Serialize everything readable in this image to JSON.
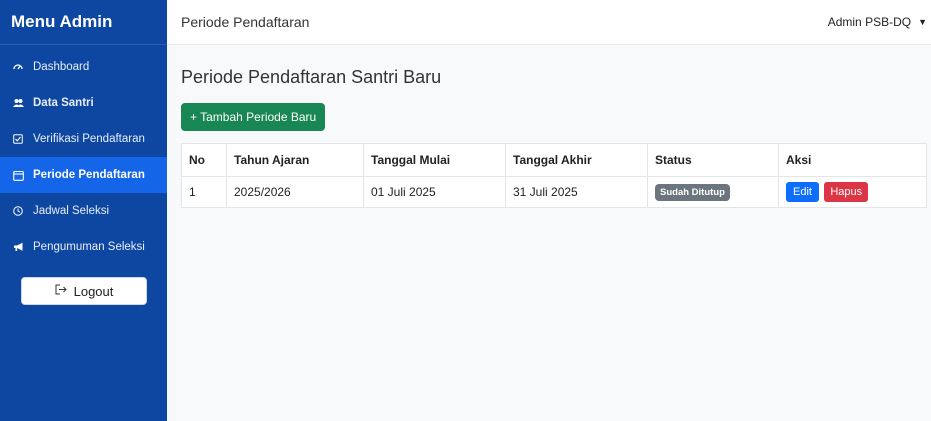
{
  "sidebar": {
    "title": "Menu Admin",
    "items": [
      {
        "label": "Dashboard",
        "icon": "dashboard-icon"
      },
      {
        "label": "Data Santri",
        "icon": "users-icon"
      },
      {
        "label": "Verifikasi Pendaftaran",
        "icon": "check-square-icon"
      },
      {
        "label": "Periode Pendaftaran",
        "icon": "calendar-icon",
        "active": true
      },
      {
        "label": "Jadwal Seleksi",
        "icon": "clock-icon"
      },
      {
        "label": "Pengumuman Seleksi",
        "icon": "megaphone-icon"
      }
    ],
    "logout_label": "Logout"
  },
  "topbar": {
    "title": "Periode Pendaftaran",
    "user": "Admin PSB-DQ"
  },
  "main": {
    "page_title": "Periode Pendaftaran Santri Baru",
    "add_button": "+ Tambah Periode Baru",
    "table": {
      "headers": [
        "No",
        "Tahun Ajaran",
        "Tanggal Mulai",
        "Tanggal Akhir",
        "Status",
        "Aksi"
      ],
      "rows": [
        {
          "no": "1",
          "tahun_ajaran": "2025/2026",
          "tanggal_mulai": "01 Juli 2025",
          "tanggal_akhir": "31 Juli 2025",
          "status": "Sudah Ditutup",
          "edit": "Edit",
          "hapus": "Hapus"
        }
      ]
    }
  },
  "colors": {
    "sidebar_bg": "#0d47a1",
    "sidebar_active": "#1565e8",
    "add_button": "#198754",
    "edit_button": "#0d6efd",
    "delete_button": "#dc3545",
    "status_badge": "#6c757d"
  }
}
